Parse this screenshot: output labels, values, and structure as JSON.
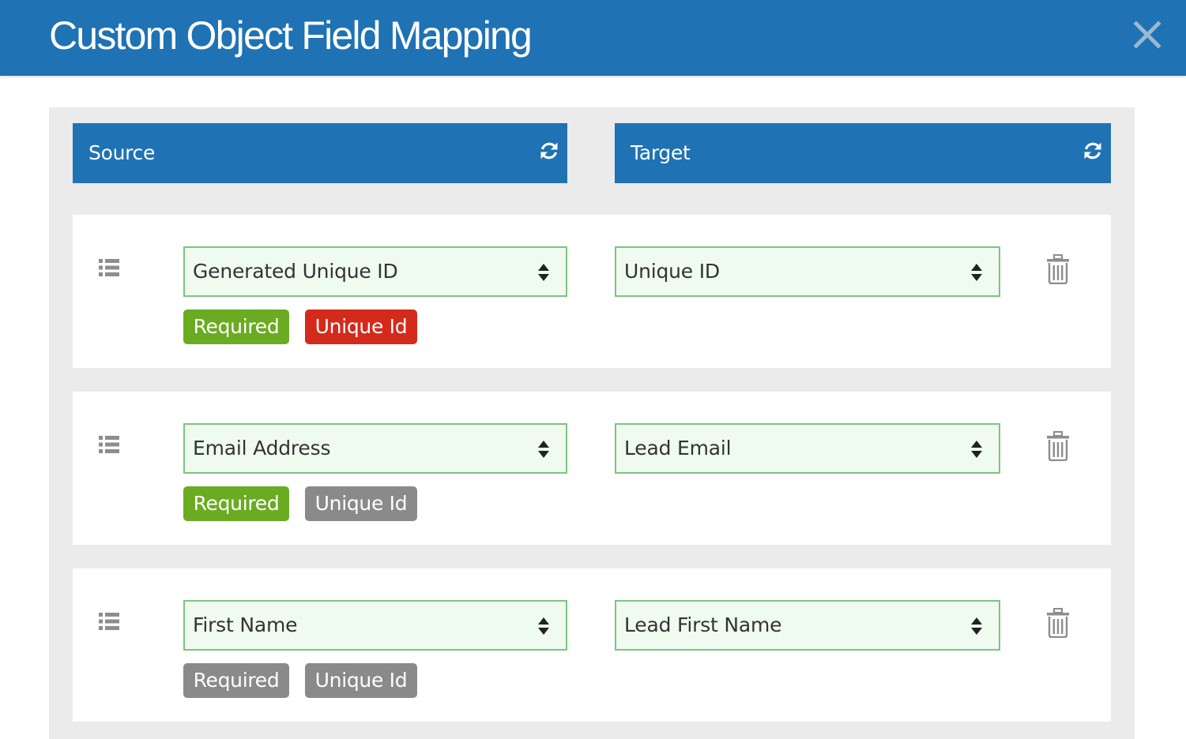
{
  "modal": {
    "title": "Custom Object Field Mapping",
    "close_icon": "close-icon"
  },
  "columns": {
    "source": {
      "label": "Source",
      "icon": "refresh-icon"
    },
    "target": {
      "label": "Target",
      "icon": "refresh-icon"
    }
  },
  "colors": {
    "header_blue": "#1f72b3",
    "select_border": "#7cc57f",
    "select_bg": "#f0fbf0",
    "badge_active_green": "#6aab22",
    "badge_active_red": "#d42a1b",
    "badge_inactive_gray": "#8a8a8a"
  },
  "mappings": [
    {
      "source": "Generated Unique ID",
      "target": "Unique ID",
      "required": {
        "label": "Required",
        "active": true
      },
      "unique_id": {
        "label": "Unique Id",
        "active": true
      }
    },
    {
      "source": "Email Address",
      "target": "Lead Email",
      "required": {
        "label": "Required",
        "active": true
      },
      "unique_id": {
        "label": "Unique Id",
        "active": false
      }
    },
    {
      "source": "First Name",
      "target": "Lead First Name",
      "required": {
        "label": "Required",
        "active": false
      },
      "unique_id": {
        "label": "Unique Id",
        "active": false
      }
    }
  ]
}
